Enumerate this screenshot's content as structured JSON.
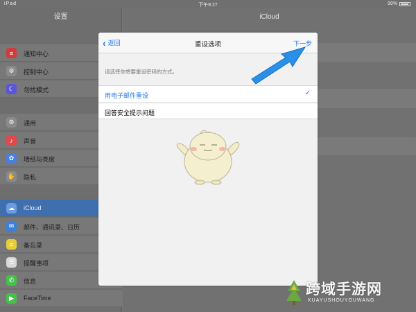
{
  "status_bar": {
    "carrier": "iPad",
    "time": "下午9:27",
    "battery": "99%"
  },
  "sidebar": {
    "title": "设置",
    "items": [
      {
        "label": "通知中心",
        "icon": "notification-icon",
        "color": "#d23b3b"
      },
      {
        "label": "控制中心",
        "icon": "control-center-icon",
        "color": "#8a8a8a"
      },
      {
        "label": "勿扰模式",
        "icon": "moon-icon",
        "color": "#5a57d6"
      },
      {
        "label": "通用",
        "icon": "gear-icon",
        "color": "#8a8a8a"
      },
      {
        "label": "声音",
        "icon": "speaker-icon",
        "color": "#e1484b"
      },
      {
        "label": "墙纸与亮度",
        "icon": "flower-icon",
        "color": "#4a7fdc"
      },
      {
        "label": "隐私",
        "icon": "hand-icon",
        "color": "#8a8a8a"
      },
      {
        "label": "iCloud",
        "icon": "cloud-icon",
        "color": "#6c9be0"
      },
      {
        "label": "邮件、通讯录、日历",
        "icon": "mail-icon",
        "color": "#3b7fe0"
      },
      {
        "label": "备忘录",
        "icon": "notes-icon",
        "color": "#e8cd3a"
      },
      {
        "label": "提醒事项",
        "icon": "reminders-icon",
        "color": "#d8d8d8"
      },
      {
        "label": "信息",
        "icon": "message-icon",
        "color": "#45c14b"
      },
      {
        "label": "FaceTime",
        "icon": "video-icon",
        "color": "#45c14b"
      }
    ]
  },
  "detail": {
    "title": "iCloud"
  },
  "modal": {
    "back_label": "返回",
    "title": "重设选项",
    "next_label": "下一步",
    "hint": "请选择你想要重设密码的方式。",
    "options": [
      {
        "label": "用电子邮件重设",
        "selected": true
      },
      {
        "label": "回答安全提示问题",
        "selected": false
      }
    ]
  },
  "watermark": {
    "title": "跨域手游网",
    "subtitle": "KUAYUSHOUYOUWANG"
  },
  "colors": {
    "accent": "#1e77e8",
    "sidebar_selected": "#3f6fae",
    "arrow": "#2a8fe6"
  }
}
